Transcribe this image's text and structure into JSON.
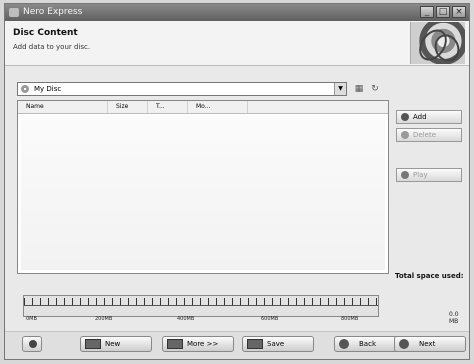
{
  "window": {
    "title": "Nero Express"
  },
  "header": {
    "title": "Disc Content",
    "subtitle": "Add data to your disc."
  },
  "disc": {
    "name": "My Disc"
  },
  "table": {
    "columns": [
      "Name",
      "Size",
      "T...",
      "Mo..."
    ]
  },
  "side_buttons": {
    "add": "Add",
    "delete": "Delete",
    "play": "Play"
  },
  "status": {
    "total_space": "Total space used:"
  },
  "gauge": {
    "tick_labels": [
      "0MB",
      "200MB",
      "400MB",
      "600MB",
      "800MB"
    ],
    "value": "0.0 MB"
  },
  "bottom_buttons": {
    "new": "New",
    "more": "More >>",
    "save": "Save",
    "back": "Back",
    "next": "Next"
  },
  "icons": {
    "app": "nero-icon",
    "disc": "disc-icon",
    "help": "help-icon",
    "toolbar": [
      "new-folder-icon",
      "refresh-icon"
    ]
  }
}
